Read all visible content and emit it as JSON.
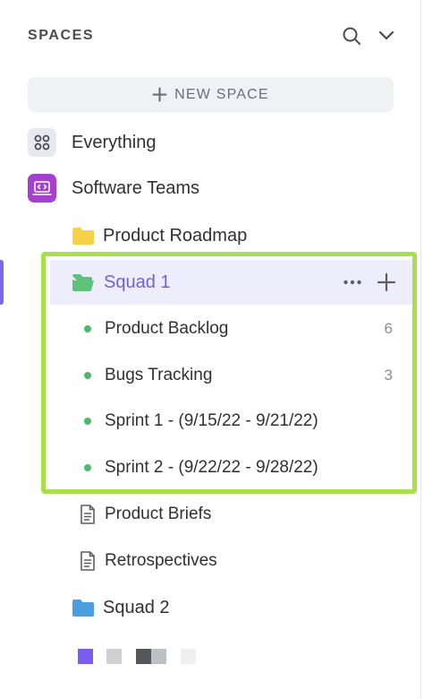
{
  "header": {
    "title": "SPACES"
  },
  "new_space": {
    "label": "NEW SPACE"
  },
  "items": {
    "everything": "Everything",
    "software_teams": "Software Teams",
    "product_roadmap": "Product Roadmap",
    "squad1": "Squad 1",
    "product_briefs": "Product Briefs",
    "retrospectives": "Retrospectives",
    "squad2": "Squad 2"
  },
  "squad1_lists": [
    {
      "label": "Product Backlog",
      "count": "6"
    },
    {
      "label": "Bugs Tracking",
      "count": "3"
    },
    {
      "label": "Sprint 1 - (9/15/22 - 9/21/22)",
      "count": ""
    },
    {
      "label": "Sprint 2 - (9/22/22 - 9/28/22)",
      "count": ""
    }
  ],
  "colors": {
    "accent": "#7b68ee",
    "space_software_teams": "#a53fd0",
    "list_dot": "#4cba6a",
    "folder_roadmap": "#f9d04a",
    "folder_squad1": "#5fc27a",
    "folder_squad2": "#4a9fe0",
    "highlight": "#a6e04a"
  },
  "icons": {
    "search": "search-icon",
    "collapse": "chevron-down-icon",
    "plus": "plus-icon",
    "everything": "grid-circles-icon",
    "software_teams": "code-laptop-icon",
    "folder": "folder-icon",
    "doc": "document-icon",
    "more": "more-horizontal-icon"
  }
}
